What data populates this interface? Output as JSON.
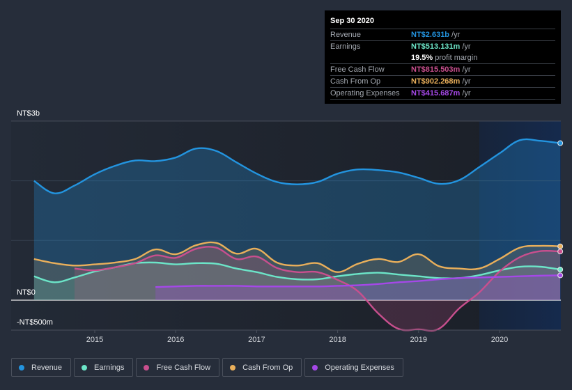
{
  "tooltip": {
    "date": "Sep 30 2020",
    "rows": [
      {
        "label": "Revenue",
        "value": "NT$2.631b",
        "unit": "/yr",
        "color": "#2394df"
      },
      {
        "label": "Earnings",
        "value": "NT$513.131m",
        "unit": "/yr",
        "color": "#6ce5c8"
      },
      {
        "label": "",
        "value": "19.5%",
        "unit": "profit margin",
        "color": "#ffffff"
      },
      {
        "label": "Free Cash Flow",
        "value": "NT$815.503m",
        "unit": "/yr",
        "color": "#c94f8e"
      },
      {
        "label": "Cash From Op",
        "value": "NT$902.268m",
        "unit": "/yr",
        "color": "#e9af5b"
      },
      {
        "label": "Operating Expenses",
        "value": "NT$415.687m",
        "unit": "/yr",
        "color": "#a548e8"
      }
    ]
  },
  "legend": [
    {
      "label": "Revenue",
      "color": "#2394df"
    },
    {
      "label": "Earnings",
      "color": "#6ce5c8"
    },
    {
      "label": "Free Cash Flow",
      "color": "#c94f8e"
    },
    {
      "label": "Cash From Op",
      "color": "#e9af5b"
    },
    {
      "label": "Operating Expenses",
      "color": "#a548e8"
    }
  ],
  "chart_data": {
    "type": "area",
    "title": "",
    "xlabel": "",
    "ylabel": "",
    "y_unit": "NT$ billions",
    "ylim": [
      -0.5,
      3.0
    ],
    "xlim": [
      2014.0,
      2020.75
    ],
    "y_tick_labels": [
      {
        "value": 3.0,
        "label": "NT$3b"
      },
      {
        "value": 0.0,
        "label": "NT$0"
      },
      {
        "value": -0.5,
        "label": "-NT$500m"
      }
    ],
    "x_ticks": [
      2015,
      2016,
      2017,
      2018,
      2019,
      2020
    ],
    "x_tick_labels": [
      "2015",
      "2016",
      "2017",
      "2018",
      "2019",
      "2020"
    ],
    "grid": true,
    "highlight_start": 2019.75,
    "legend_position": "bottom",
    "x": [
      2014.25,
      2014.5,
      2014.75,
      2015.0,
      2015.25,
      2015.5,
      2015.75,
      2016.0,
      2016.25,
      2016.5,
      2016.75,
      2017.0,
      2017.25,
      2017.5,
      2017.75,
      2018.0,
      2018.25,
      2018.5,
      2018.75,
      2019.0,
      2019.25,
      2019.5,
      2019.75,
      2020.0,
      2020.25,
      2020.5,
      2020.75
    ],
    "series": [
      {
        "name": "Revenue",
        "color": "#2394df",
        "values": [
          2.0,
          1.79,
          1.92,
          2.11,
          2.25,
          2.34,
          2.33,
          2.39,
          2.54,
          2.5,
          2.31,
          2.12,
          1.98,
          1.94,
          1.98,
          2.12,
          2.19,
          2.18,
          2.14,
          2.05,
          1.95,
          2.01,
          2.23,
          2.46,
          2.68,
          2.67,
          2.631
        ]
      },
      {
        "name": "Earnings",
        "color": "#6ce5c8",
        "values": [
          0.4,
          0.3,
          0.38,
          0.48,
          0.55,
          0.62,
          0.63,
          0.6,
          0.62,
          0.61,
          0.53,
          0.47,
          0.39,
          0.35,
          0.35,
          0.4,
          0.44,
          0.46,
          0.43,
          0.4,
          0.37,
          0.37,
          0.42,
          0.5,
          0.56,
          0.56,
          0.513
        ]
      },
      {
        "name": "Free Cash Flow",
        "color": "#c94f8e",
        "values": [
          null,
          null,
          0.53,
          0.5,
          0.55,
          0.62,
          0.75,
          0.71,
          0.86,
          0.88,
          0.69,
          0.73,
          0.54,
          0.47,
          0.47,
          0.34,
          0.15,
          -0.22,
          -0.48,
          -0.49,
          -0.48,
          -0.14,
          0.13,
          0.48,
          0.72,
          0.82,
          0.8155
        ]
      },
      {
        "name": "Cash From Op",
        "color": "#e9af5b",
        "values": [
          0.69,
          0.62,
          0.58,
          0.6,
          0.63,
          0.69,
          0.85,
          0.77,
          0.92,
          0.96,
          0.78,
          0.86,
          0.63,
          0.58,
          0.62,
          0.47,
          0.61,
          0.69,
          0.64,
          0.77,
          0.57,
          0.53,
          0.53,
          0.69,
          0.88,
          0.91,
          0.902
        ]
      },
      {
        "name": "Operating Expenses",
        "color": "#a548e8",
        "values": [
          null,
          null,
          null,
          null,
          null,
          null,
          0.22,
          0.23,
          0.24,
          0.24,
          0.24,
          0.23,
          0.23,
          0.23,
          0.23,
          0.24,
          0.25,
          0.27,
          0.3,
          0.32,
          0.35,
          0.37,
          0.38,
          0.39,
          0.4,
          0.41,
          0.4157
        ]
      }
    ]
  }
}
